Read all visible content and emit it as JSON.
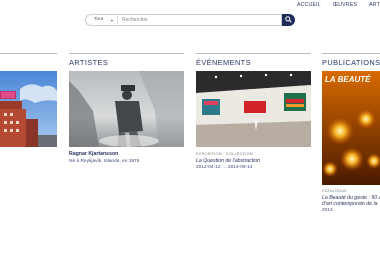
{
  "nav": {
    "items": [
      "ACCUEIL",
      "ŒUVRES",
      "ART"
    ]
  },
  "search": {
    "scope": "Tout",
    "placeholder": "Rechercher"
  },
  "sections": {
    "artists": {
      "title": "ARTISTES",
      "name": "Ragnar Kjartansson",
      "detail": "Né à Reykjavík, Islande, en 1976"
    },
    "events": {
      "title": "ÉVÉNEMENTS",
      "category": "EXPOSITION · COLLECTION",
      "name": "La Question de l'abstraction",
      "dates": "2012-04-12  →  2014-09-14"
    },
    "publications": {
      "title": "PUBLICATIONS",
      "cover_text": "LA BEAUTÉ",
      "category": "CATALOGUE",
      "name_line1": "La Beauté du geste : 50 a",
      "name_line2": "d'art contemporain de la",
      "year": "2014"
    }
  },
  "colors": {
    "accent": "#1e2c5a",
    "text": "#2a3560",
    "rule": "#b8bcc6"
  }
}
